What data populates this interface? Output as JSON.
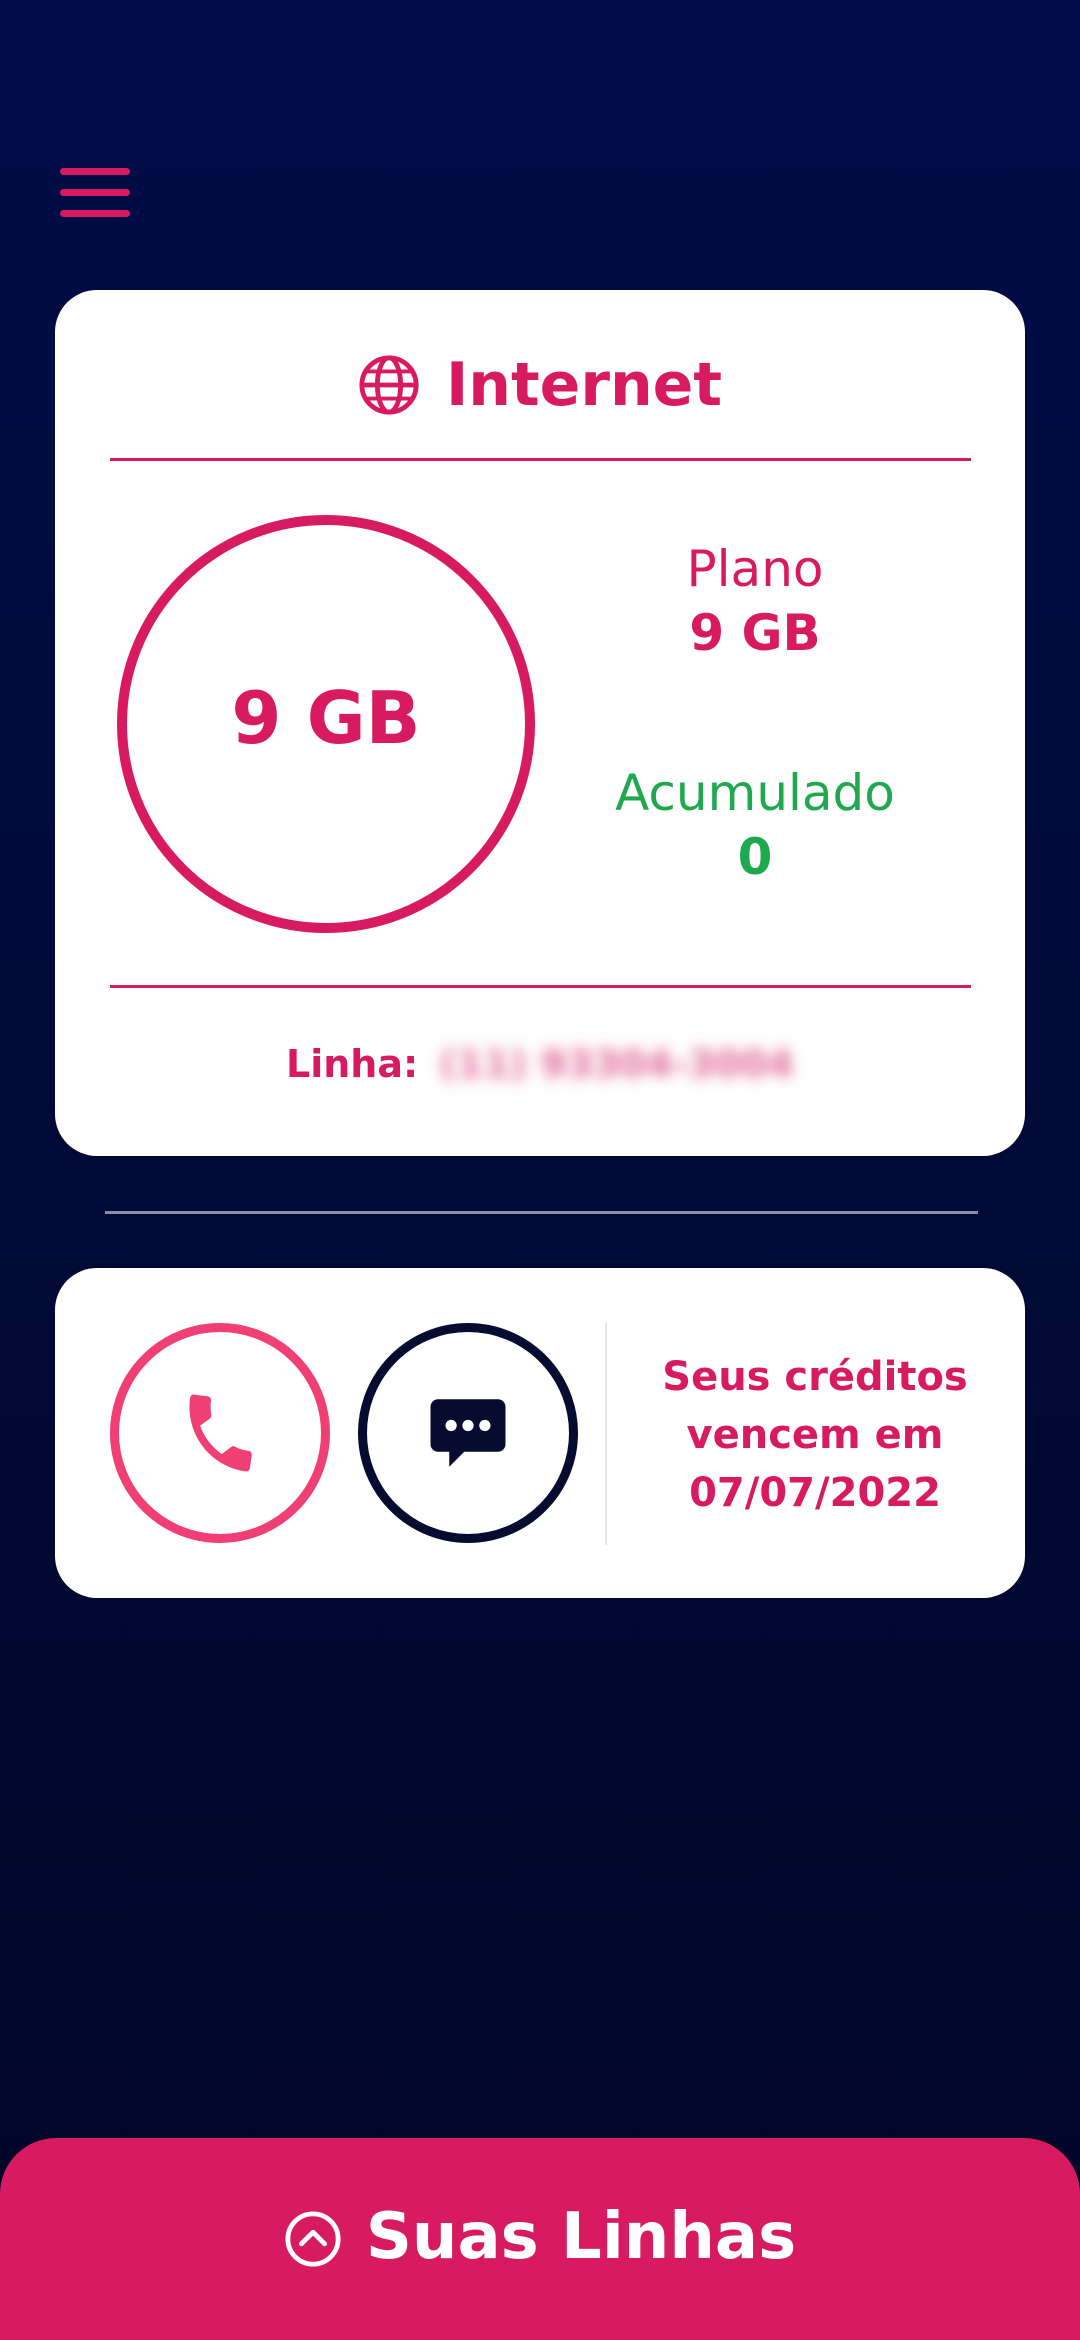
{
  "colors": {
    "accent": "#d81b60",
    "accumulated": "#1fa94f",
    "background": "#010d48",
    "call_button": "#ef3f74",
    "sms_button": "#050c30"
  },
  "header": {
    "menu_icon": "hamburger-menu-icon"
  },
  "internet_card": {
    "icon": "globe-icon",
    "title": "Internet",
    "ring_value": "9 GB",
    "plan_label": "Plano",
    "plan_value": "9 GB",
    "accumulated_label": "Acumulado",
    "accumulated_value": "0",
    "line_label": "Linha:",
    "line_number": "(11) 93304-3004"
  },
  "actions_card": {
    "call_icon": "phone-icon",
    "sms_icon": "chat-bubble-icon",
    "credits_line1": "Seus créditos",
    "credits_line2": "vencem em",
    "credits_date": "07/07/2022"
  },
  "bottom_bar": {
    "icon": "chevron-up-circle-icon",
    "label": "Suas Linhas"
  }
}
